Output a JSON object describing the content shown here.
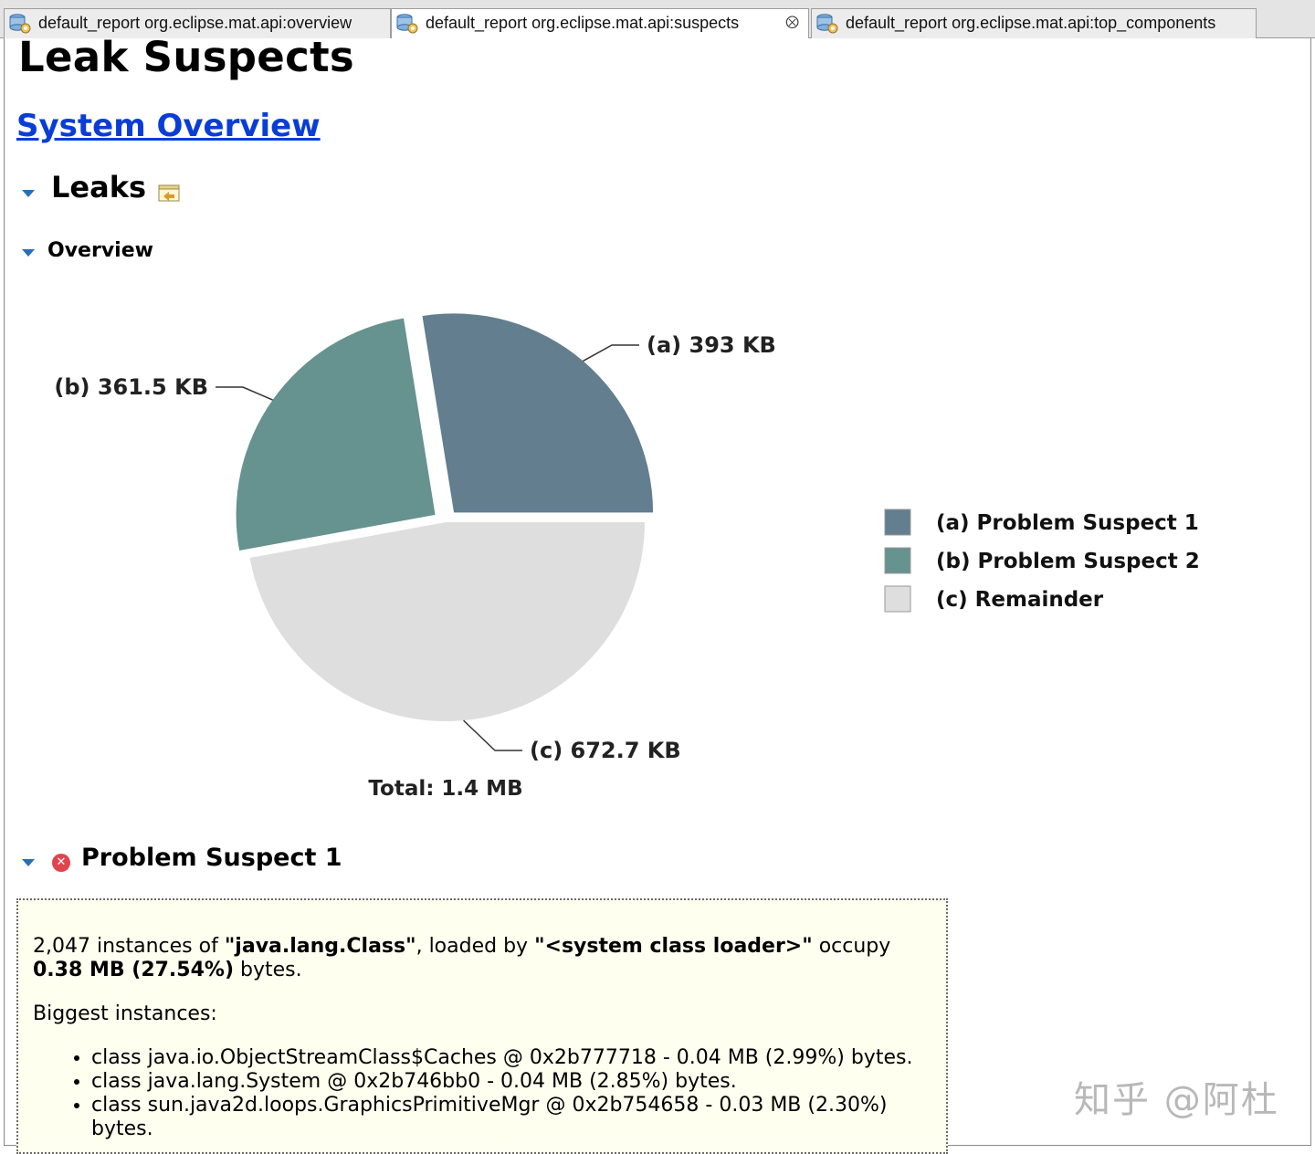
{
  "tabs": [
    {
      "label": "default_report  org.eclipse.mat.api:overview",
      "active": false
    },
    {
      "label": "default_report  org.eclipse.mat.api:suspects",
      "active": true,
      "close_icon": "close-icon"
    },
    {
      "label": "default_report  org.eclipse.mat.api:top_components",
      "active": false
    }
  ],
  "page": {
    "title": "Leak Suspects",
    "system_overview_link": "System Overview"
  },
  "leaks": {
    "heading": "Leaks",
    "overview_heading": "Overview"
  },
  "chart_data": {
    "type": "pie",
    "slices": [
      {
        "key": "(a)",
        "value": 393,
        "label": "393 KB",
        "legend": "Problem Suspect 1",
        "color": "#627e8f"
      },
      {
        "key": "(b)",
        "value": 361.5,
        "label": "361.5 KB",
        "legend": "Problem Suspect 2",
        "color": "#66928f"
      },
      {
        "key": "(c)",
        "value": 672.7,
        "label": "672.7 KB",
        "legend": "Remainder",
        "color": "#dedede"
      }
    ],
    "unit": "KB",
    "total_label": "Total: 1.4 MB",
    "legend_position": "right",
    "exploded_slices": [
      "(a)",
      "(b)"
    ]
  },
  "suspect1": {
    "heading": "Problem Suspect 1",
    "summary": {
      "count": "2,047",
      "t1": " instances of ",
      "class_name": "\"java.lang.Class\"",
      "t2": ", loaded by ",
      "loader": "\"<system class loader>\"",
      "t3": " occupy ",
      "size": "0.38 MB (27.54%)",
      "t4": " bytes."
    },
    "biggest_label": "Biggest instances:",
    "instances": [
      "class java.io.ObjectStreamClass$Caches @ 0x2b777718 - 0.04 MB (2.99%) bytes.",
      "class java.lang.System @ 0x2b746bb0 - 0.04 MB (2.85%) bytes.",
      "class sun.java2d.loops.GraphicsPrimitiveMgr @ 0x2b754658 - 0.03 MB (2.30%) bytes."
    ]
  },
  "watermark": "知乎 @阿杜"
}
